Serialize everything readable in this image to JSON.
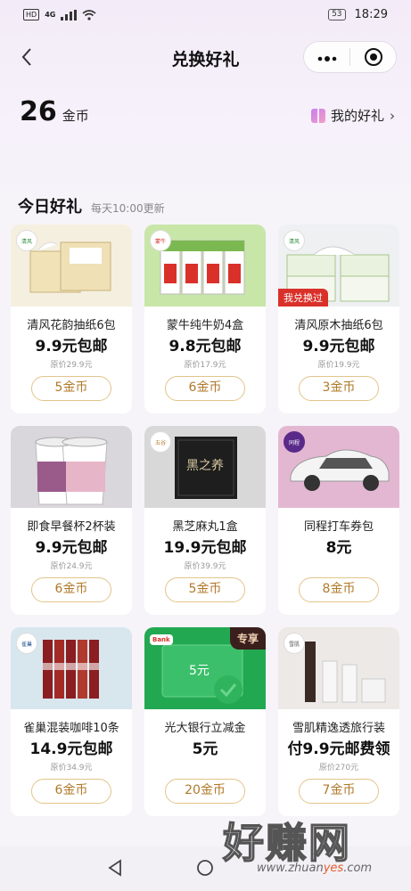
{
  "status": {
    "network": "HD",
    "signal": "4G",
    "battery": "53",
    "time": "18:29"
  },
  "nav": {
    "back_icon": "chevron-left-icon",
    "title": "兑换好礼",
    "more_icon": "more-dots-icon",
    "close_icon": "target-icon"
  },
  "header": {
    "coins_value": "26",
    "coins_unit": "金币",
    "my_gifts_label": "我的好礼"
  },
  "section": {
    "title": "今日好礼",
    "subtitle": "每天10:00更新"
  },
  "products": [
    {
      "name": "清风花韵抽纸6包",
      "price": "9.9元包邮",
      "original": "原价29.9元",
      "cost": "5金币"
    },
    {
      "name": "蒙牛纯牛奶4盒",
      "price": "9.8元包邮",
      "original": "原价17.9元",
      "cost": "6金币"
    },
    {
      "name": "清风原木抽纸6包",
      "price": "9.9元包邮",
      "original": "原价19.9元",
      "cost": "3金币",
      "tag": "我兑换过"
    },
    {
      "name": "即食早餐杯2杯装",
      "price": "9.9元包邮",
      "original": "原价24.9元",
      "cost": "6金币"
    },
    {
      "name": "黑芝麻丸1盒",
      "price": "19.9元包邮",
      "original": "原价39.9元",
      "cost": "5金币",
      "img_text": "黑之养"
    },
    {
      "name": "同程打车券包",
      "price": "8元",
      "original": "",
      "cost": "8金币"
    },
    {
      "name": "雀巢混装咖啡10条",
      "price": "14.9元包邮",
      "original": "原价34.9元",
      "cost": "6金币"
    },
    {
      "name": "光大银行立减金",
      "price": "5元",
      "original": "",
      "cost": "20金币",
      "tag": "专享",
      "img_text": "5元",
      "brand": "Bank"
    },
    {
      "name": "雪肌精逸透旅行装",
      "price": "付9.9元邮费领",
      "original": "原价270元",
      "cost": "7金币"
    }
  ],
  "colors": {
    "accent": "#b07a2a",
    "button_border": "#e3c48a",
    "tag_red": "#d9312a",
    "tag_dark": "#3b1f1c",
    "page_bg": "#f6f4f9"
  },
  "watermark": {
    "text": "好赚网",
    "url_prefix": "www.zhuan",
    "url_accent": "yes",
    "url_suffix": ".com"
  }
}
